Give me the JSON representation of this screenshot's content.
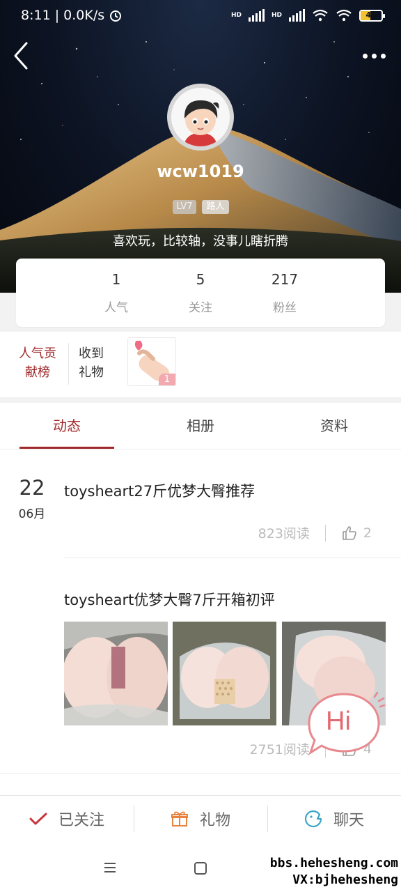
{
  "status_bar": {
    "time_speed": "8:11 | 0.0K/s",
    "network_1": "HD",
    "network_2": "HD",
    "battery_level": "45"
  },
  "profile": {
    "username": "wcw1019",
    "level_badge": "LV7",
    "role_badge": "路人",
    "bio": "喜欢玩，比较轴，没事儿瞎折腾"
  },
  "stats": [
    {
      "value": "1",
      "label": "人气"
    },
    {
      "value": "5",
      "label": "关注"
    },
    {
      "value": "217",
      "label": "粉丝"
    }
  ],
  "contribution": {
    "rank_link": "人气贡献榜",
    "gift_label": "收到礼物",
    "gift_count": "1"
  },
  "tabs": [
    {
      "label": "动态",
      "active": true
    },
    {
      "label": "相册",
      "active": false
    },
    {
      "label": "资料",
      "active": false
    }
  ],
  "posts": [
    {
      "date_day": "22",
      "date_month": "06月",
      "title": "toysheart27斤优梦大臀推荐",
      "reads": "823阅读",
      "likes": "2"
    },
    {
      "title": "toysheart优梦大臀7斤开箱初评",
      "reads": "2751阅读",
      "likes": "4"
    }
  ],
  "hi_bubble": "Hi",
  "actions": [
    {
      "label": "已关注",
      "icon": "check-icon"
    },
    {
      "label": "礼物",
      "icon": "gift-icon"
    },
    {
      "label": "聊天",
      "icon": "chat-icon"
    }
  ],
  "watermark": {
    "line1": "bbs.hehesheng.com",
    "line2": "VX:bjhehesheng"
  },
  "colors": {
    "accent": "#a0282a",
    "muted": "#999999",
    "gift_badge": "#f3a9b0"
  }
}
